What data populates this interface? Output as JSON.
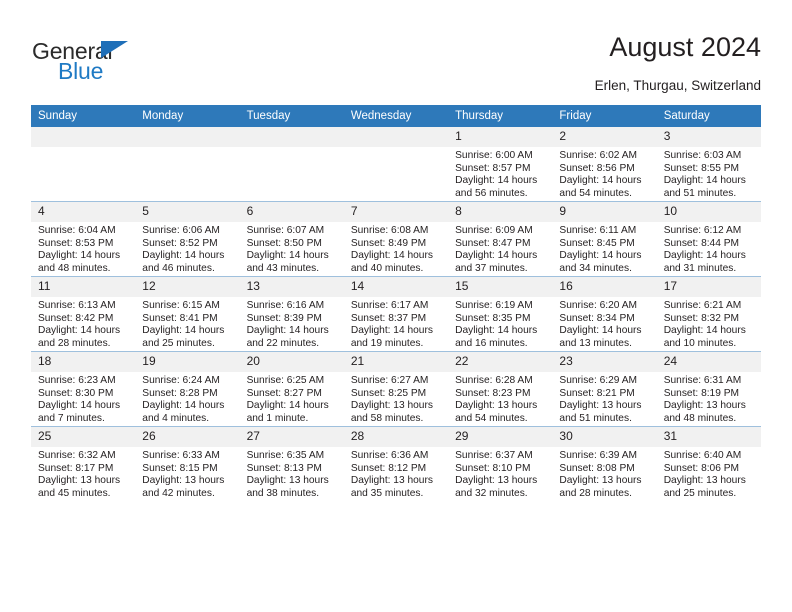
{
  "brand": {
    "name_part1": "General",
    "name_part2": "Blue",
    "triangle_color": "#1f6fb8",
    "blue_color": "#1f7ac4"
  },
  "header": {
    "title": "August 2024",
    "subtitle": "Erlen, Thurgau, Switzerland",
    "header_bg": "#2e79ba",
    "header_text_color": "#ffffff",
    "daynum_bg": "#f1f1f1"
  },
  "weekdays": [
    "Sunday",
    "Monday",
    "Tuesday",
    "Wednesday",
    "Thursday",
    "Friday",
    "Saturday"
  ],
  "weeks": [
    [
      {
        "day": "",
        "sunrise": "",
        "sunset": "",
        "daylight1": "",
        "daylight2": ""
      },
      {
        "day": "",
        "sunrise": "",
        "sunset": "",
        "daylight1": "",
        "daylight2": ""
      },
      {
        "day": "",
        "sunrise": "",
        "sunset": "",
        "daylight1": "",
        "daylight2": ""
      },
      {
        "day": "",
        "sunrise": "",
        "sunset": "",
        "daylight1": "",
        "daylight2": ""
      },
      {
        "day": "1",
        "sunrise": "Sunrise: 6:00 AM",
        "sunset": "Sunset: 8:57 PM",
        "daylight1": "Daylight: 14 hours",
        "daylight2": "and 56 minutes."
      },
      {
        "day": "2",
        "sunrise": "Sunrise: 6:02 AM",
        "sunset": "Sunset: 8:56 PM",
        "daylight1": "Daylight: 14 hours",
        "daylight2": "and 54 minutes."
      },
      {
        "day": "3",
        "sunrise": "Sunrise: 6:03 AM",
        "sunset": "Sunset: 8:55 PM",
        "daylight1": "Daylight: 14 hours",
        "daylight2": "and 51 minutes."
      }
    ],
    [
      {
        "day": "4",
        "sunrise": "Sunrise: 6:04 AM",
        "sunset": "Sunset: 8:53 PM",
        "daylight1": "Daylight: 14 hours",
        "daylight2": "and 48 minutes."
      },
      {
        "day": "5",
        "sunrise": "Sunrise: 6:06 AM",
        "sunset": "Sunset: 8:52 PM",
        "daylight1": "Daylight: 14 hours",
        "daylight2": "and 46 minutes."
      },
      {
        "day": "6",
        "sunrise": "Sunrise: 6:07 AM",
        "sunset": "Sunset: 8:50 PM",
        "daylight1": "Daylight: 14 hours",
        "daylight2": "and 43 minutes."
      },
      {
        "day": "7",
        "sunrise": "Sunrise: 6:08 AM",
        "sunset": "Sunset: 8:49 PM",
        "daylight1": "Daylight: 14 hours",
        "daylight2": "and 40 minutes."
      },
      {
        "day": "8",
        "sunrise": "Sunrise: 6:09 AM",
        "sunset": "Sunset: 8:47 PM",
        "daylight1": "Daylight: 14 hours",
        "daylight2": "and 37 minutes."
      },
      {
        "day": "9",
        "sunrise": "Sunrise: 6:11 AM",
        "sunset": "Sunset: 8:45 PM",
        "daylight1": "Daylight: 14 hours",
        "daylight2": "and 34 minutes."
      },
      {
        "day": "10",
        "sunrise": "Sunrise: 6:12 AM",
        "sunset": "Sunset: 8:44 PM",
        "daylight1": "Daylight: 14 hours",
        "daylight2": "and 31 minutes."
      }
    ],
    [
      {
        "day": "11",
        "sunrise": "Sunrise: 6:13 AM",
        "sunset": "Sunset: 8:42 PM",
        "daylight1": "Daylight: 14 hours",
        "daylight2": "and 28 minutes."
      },
      {
        "day": "12",
        "sunrise": "Sunrise: 6:15 AM",
        "sunset": "Sunset: 8:41 PM",
        "daylight1": "Daylight: 14 hours",
        "daylight2": "and 25 minutes."
      },
      {
        "day": "13",
        "sunrise": "Sunrise: 6:16 AM",
        "sunset": "Sunset: 8:39 PM",
        "daylight1": "Daylight: 14 hours",
        "daylight2": "and 22 minutes."
      },
      {
        "day": "14",
        "sunrise": "Sunrise: 6:17 AM",
        "sunset": "Sunset: 8:37 PM",
        "daylight1": "Daylight: 14 hours",
        "daylight2": "and 19 minutes."
      },
      {
        "day": "15",
        "sunrise": "Sunrise: 6:19 AM",
        "sunset": "Sunset: 8:35 PM",
        "daylight1": "Daylight: 14 hours",
        "daylight2": "and 16 minutes."
      },
      {
        "day": "16",
        "sunrise": "Sunrise: 6:20 AM",
        "sunset": "Sunset: 8:34 PM",
        "daylight1": "Daylight: 14 hours",
        "daylight2": "and 13 minutes."
      },
      {
        "day": "17",
        "sunrise": "Sunrise: 6:21 AM",
        "sunset": "Sunset: 8:32 PM",
        "daylight1": "Daylight: 14 hours",
        "daylight2": "and 10 minutes."
      }
    ],
    [
      {
        "day": "18",
        "sunrise": "Sunrise: 6:23 AM",
        "sunset": "Sunset: 8:30 PM",
        "daylight1": "Daylight: 14 hours",
        "daylight2": "and 7 minutes."
      },
      {
        "day": "19",
        "sunrise": "Sunrise: 6:24 AM",
        "sunset": "Sunset: 8:28 PM",
        "daylight1": "Daylight: 14 hours",
        "daylight2": "and 4 minutes."
      },
      {
        "day": "20",
        "sunrise": "Sunrise: 6:25 AM",
        "sunset": "Sunset: 8:27 PM",
        "daylight1": "Daylight: 14 hours",
        "daylight2": "and 1 minute."
      },
      {
        "day": "21",
        "sunrise": "Sunrise: 6:27 AM",
        "sunset": "Sunset: 8:25 PM",
        "daylight1": "Daylight: 13 hours",
        "daylight2": "and 58 minutes."
      },
      {
        "day": "22",
        "sunrise": "Sunrise: 6:28 AM",
        "sunset": "Sunset: 8:23 PM",
        "daylight1": "Daylight: 13 hours",
        "daylight2": "and 54 minutes."
      },
      {
        "day": "23",
        "sunrise": "Sunrise: 6:29 AM",
        "sunset": "Sunset: 8:21 PM",
        "daylight1": "Daylight: 13 hours",
        "daylight2": "and 51 minutes."
      },
      {
        "day": "24",
        "sunrise": "Sunrise: 6:31 AM",
        "sunset": "Sunset: 8:19 PM",
        "daylight1": "Daylight: 13 hours",
        "daylight2": "and 48 minutes."
      }
    ],
    [
      {
        "day": "25",
        "sunrise": "Sunrise: 6:32 AM",
        "sunset": "Sunset: 8:17 PM",
        "daylight1": "Daylight: 13 hours",
        "daylight2": "and 45 minutes."
      },
      {
        "day": "26",
        "sunrise": "Sunrise: 6:33 AM",
        "sunset": "Sunset: 8:15 PM",
        "daylight1": "Daylight: 13 hours",
        "daylight2": "and 42 minutes."
      },
      {
        "day": "27",
        "sunrise": "Sunrise: 6:35 AM",
        "sunset": "Sunset: 8:13 PM",
        "daylight1": "Daylight: 13 hours",
        "daylight2": "and 38 minutes."
      },
      {
        "day": "28",
        "sunrise": "Sunrise: 6:36 AM",
        "sunset": "Sunset: 8:12 PM",
        "daylight1": "Daylight: 13 hours",
        "daylight2": "and 35 minutes."
      },
      {
        "day": "29",
        "sunrise": "Sunrise: 6:37 AM",
        "sunset": "Sunset: 8:10 PM",
        "daylight1": "Daylight: 13 hours",
        "daylight2": "and 32 minutes."
      },
      {
        "day": "30",
        "sunrise": "Sunrise: 6:39 AM",
        "sunset": "Sunset: 8:08 PM",
        "daylight1": "Daylight: 13 hours",
        "daylight2": "and 28 minutes."
      },
      {
        "day": "31",
        "sunrise": "Sunrise: 6:40 AM",
        "sunset": "Sunset: 8:06 PM",
        "daylight1": "Daylight: 13 hours",
        "daylight2": "and 25 minutes."
      }
    ]
  ]
}
